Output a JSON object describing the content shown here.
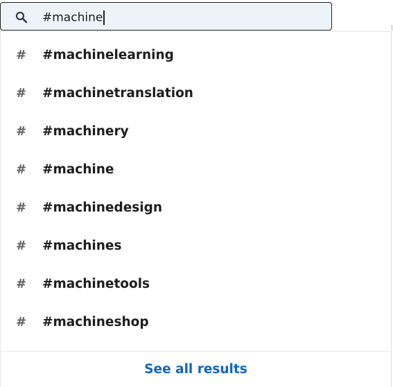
{
  "search": {
    "value": "#machine",
    "icon": "search-icon"
  },
  "suggestions": [
    {
      "icon": "hashtag-icon",
      "icon_glyph": "#",
      "label": "#machinelearning"
    },
    {
      "icon": "hashtag-icon",
      "icon_glyph": "#",
      "label": "#machinetranslation"
    },
    {
      "icon": "hashtag-icon",
      "icon_glyph": "#",
      "label": "#machinery"
    },
    {
      "icon": "hashtag-icon",
      "icon_glyph": "#",
      "label": "#machine"
    },
    {
      "icon": "hashtag-icon",
      "icon_glyph": "#",
      "label": "#machinedesign"
    },
    {
      "icon": "hashtag-icon",
      "icon_glyph": "#",
      "label": "#machines"
    },
    {
      "icon": "hashtag-icon",
      "icon_glyph": "#",
      "label": "#machinetools"
    },
    {
      "icon": "hashtag-icon",
      "icon_glyph": "#",
      "label": "#machineshop"
    }
  ],
  "footer": {
    "see_all_label": "See all results"
  },
  "colors": {
    "input_background": "#edf3f8",
    "text": "#1d1d1d",
    "icon": "#5e5e5e",
    "link": "#0a66c2"
  }
}
